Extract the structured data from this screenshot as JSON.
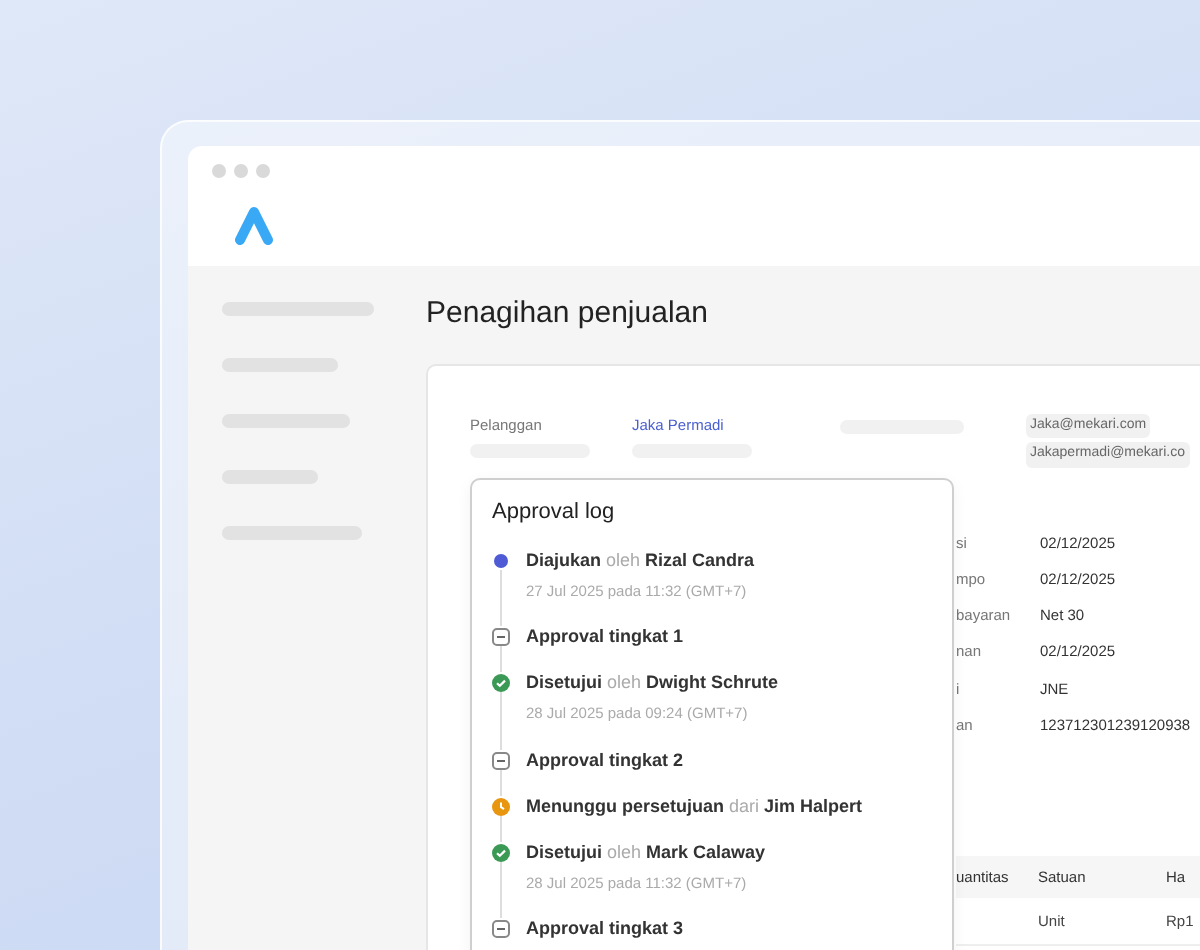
{
  "page": {
    "title": "Penagihan penjualan"
  },
  "customer": {
    "label": "Pelanggan",
    "value": "Jaka Permadi",
    "emails": [
      "Jaka@mekari.com",
      "Jakapermadi@mekari.co"
    ]
  },
  "details": [
    {
      "label": "si",
      "value": "02/12/2025"
    },
    {
      "label": "mpo",
      "value": "02/12/2025"
    },
    {
      "label": "bayaran",
      "value": "Net 30"
    },
    {
      "label": "nan",
      "value": "02/12/2025"
    },
    {
      "label": "i",
      "value": "JNE"
    },
    {
      "label": "an",
      "value": "123712301239120938"
    }
  ],
  "table": {
    "columns": [
      "uantitas",
      "Satuan",
      "Ha"
    ],
    "rows": [
      [
        "",
        "Unit",
        "Rp1"
      ]
    ]
  },
  "approval_log": {
    "title": "Approval log",
    "items": [
      {
        "kind": "submitted",
        "action": "Diajukan",
        "connector": "oleh",
        "person": "Rizal Candra",
        "time": "27 Jul 2025 pada 11:32 (GMT+7)"
      },
      {
        "kind": "level",
        "label": "Approval tingkat 1"
      },
      {
        "kind": "approved",
        "action": "Disetujui",
        "connector": "oleh",
        "person": "Dwight Schrute",
        "time": "28 Jul 2025 pada 09:24 (GMT+7)"
      },
      {
        "kind": "level",
        "label": "Approval tingkat 2"
      },
      {
        "kind": "pending",
        "action": "Menunggu persetujuan",
        "connector": "dari",
        "person": "Jim Halpert"
      },
      {
        "kind": "approved",
        "action": "Disetujui",
        "connector": "oleh",
        "person": "Mark Calaway",
        "time": "28 Jul 2025 pada 11:32 (GMT+7)"
      },
      {
        "kind": "level",
        "label": "Approval tingkat 3"
      }
    ]
  }
}
